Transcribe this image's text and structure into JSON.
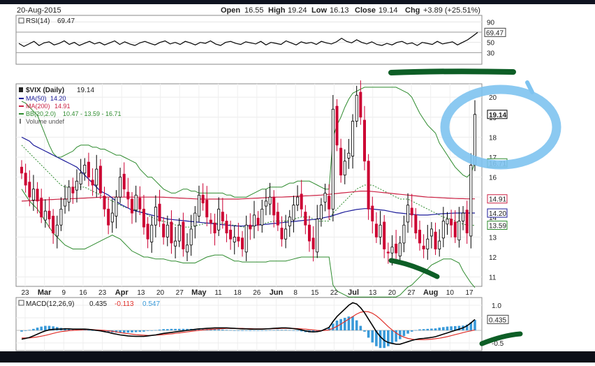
{
  "header": {
    "date": "20-Aug-2015",
    "open_label": "Open",
    "open": "16.55",
    "high_label": "High",
    "high": "19.24",
    "low_label": "Low",
    "low": "16.13",
    "close_label": "Close",
    "close": "19.14",
    "chg_label": "Chg",
    "chg": "+3.89 (+25.51%)"
  },
  "colors": {
    "price_up": "#000000",
    "price_down": "#cc0033",
    "ma50": "#1a1a99",
    "ma200": "#cc2244",
    "bb": "#2e8b2e",
    "macd": "#000000",
    "signal": "#e0302a",
    "hist": "#3a9ad9",
    "highlight_circle": "#7ec3f0",
    "marker_green": "#0d5e26"
  },
  "chart_data": [
    {
      "type": "line",
      "panel": "rsi",
      "legend": [
        {
          "label": "RSI(14)",
          "value": "69.47"
        }
      ],
      "y_ticks": [
        "90",
        "70",
        "50",
        "30"
      ],
      "ylim": [
        10,
        100
      ],
      "current_value_label": "69.47",
      "values": [
        48,
        42,
        47,
        52,
        44,
        49,
        51,
        45,
        48,
        53,
        46,
        50,
        44,
        48,
        52,
        47,
        50,
        45,
        49,
        53,
        46,
        51,
        47,
        44,
        49,
        52,
        48,
        45,
        50,
        53,
        47,
        50,
        46,
        52,
        49,
        45,
        50,
        48,
        53,
        47,
        44,
        50,
        52,
        48,
        46,
        51,
        49,
        47,
        52,
        45,
        50,
        48,
        46,
        53,
        49,
        45,
        51,
        48,
        50,
        46,
        52,
        49,
        47,
        51,
        58,
        52,
        49,
        55,
        50,
        47,
        51,
        46,
        44,
        48,
        45,
        50,
        52,
        47,
        49,
        44,
        50,
        48,
        46,
        52,
        47,
        49,
        51,
        45,
        50,
        55,
        62,
        69.47
      ]
    },
    {
      "type": "line",
      "panel": "price",
      "legend": [
        {
          "label": "$VIX (Daily)",
          "value": "19.14"
        },
        {
          "label": "MA(50)",
          "value": "14.20"
        },
        {
          "label": "MA(200)",
          "value": "14.91"
        },
        {
          "label": "BB(20,2.0)",
          "value": "10.47 - 13.59 - 16.71"
        },
        {
          "label": "Volume undef",
          "value": ""
        }
      ],
      "y_ticks": [
        "20",
        "19",
        "18",
        "17",
        "16",
        "15",
        "14",
        "13",
        "12",
        "11"
      ],
      "ylim": [
        10.6,
        20.6
      ],
      "price_tags": [
        "19.14",
        "16.71",
        "14.91",
        "14.20",
        "13.59"
      ],
      "x_ticks": [
        "23",
        "Mar",
        "9",
        "16",
        "23",
        "Apr",
        "13",
        "20",
        "27",
        "May",
        "11",
        "18",
        "26",
        "Jun",
        "8",
        "15",
        "22",
        "Jul",
        "13",
        "20",
        "27",
        "Aug",
        "10",
        "17"
      ],
      "closes": [
        16.2,
        15.6,
        15.0,
        15.4,
        14.8,
        14.0,
        14.3,
        13.9,
        13.2,
        13.6,
        14.4,
        14.9,
        15.5,
        15.2,
        15.8,
        16.2,
        16.6,
        16.0,
        15.6,
        16.4,
        15.2,
        14.4,
        13.6,
        14.2,
        15.0,
        16.0,
        15.4,
        14.9,
        14.2,
        15.1,
        14.4,
        13.5,
        12.9,
        13.6,
        14.5,
        13.8,
        13.0,
        13.6,
        12.7,
        12.8,
        13.6,
        12.4,
        12.6,
        13.4,
        14.2,
        15.1,
        14.7,
        14.0,
        13.7,
        13.2,
        14.4,
        13.8,
        13.2,
        12.9,
        13.0,
        12.8,
        12.4,
        13.6,
        13.4,
        14.1,
        13.6,
        14.4,
        14.8,
        15.0,
        14.1,
        13.6,
        12.9,
        13.4,
        14.0,
        14.6,
        15.0,
        14.4,
        13.6,
        12.8,
        12.4,
        13.9,
        14.6,
        15.2,
        14.4,
        19.4,
        17.6,
        16.1,
        16.8,
        17.2,
        18.8,
        20.1,
        19.0,
        16.8,
        14.4,
        13.8,
        13.0,
        13.6,
        12.4,
        12.2,
        12.5,
        12.2,
        12.7,
        13.6,
        14.6,
        14.1,
        13.2,
        12.7,
        12.4,
        12.9,
        13.4,
        12.4,
        12.8,
        13.8,
        13.9,
        13.6,
        13.0,
        13.8,
        14.2,
        13.2,
        16.6,
        19.14
      ],
      "ma50": [
        18.0,
        17.9,
        17.8,
        17.6,
        17.5,
        17.4,
        17.3,
        17.2,
        17.1,
        17.0,
        16.9,
        16.8,
        16.7,
        16.6,
        16.5,
        16.3,
        16.1,
        15.9,
        15.7,
        15.5,
        15.3,
        15.2,
        15.1,
        14.95,
        14.8,
        14.65,
        14.55,
        14.45,
        14.35,
        14.3,
        14.25,
        14.2,
        14.15,
        14.1,
        14.05,
        14.0,
        13.95,
        13.9,
        13.88,
        13.86,
        13.84,
        13.82,
        13.8,
        13.78,
        13.76,
        13.74,
        13.72,
        13.7,
        13.68,
        13.66,
        13.64,
        13.62,
        13.6,
        13.58,
        13.56,
        13.55,
        13.55,
        13.56,
        13.57,
        13.58,
        13.6,
        13.62,
        13.64,
        13.66,
        13.68,
        13.7,
        13.72,
        13.74,
        13.76,
        13.78,
        13.8,
        13.82,
        13.84,
        13.86,
        13.88,
        13.9,
        13.94,
        13.98,
        14.02,
        14.08,
        14.14,
        14.2,
        14.26,
        14.3,
        14.34,
        14.38,
        14.4,
        14.42,
        14.42,
        14.4,
        14.38,
        14.36,
        14.34,
        14.3,
        14.26,
        14.22,
        14.2,
        14.18,
        14.16,
        14.14,
        14.12,
        14.1,
        14.1,
        14.1,
        14.12,
        14.14,
        14.16,
        14.17,
        14.18,
        14.19,
        14.2,
        14.2,
        14.2,
        14.2,
        14.2,
        14.2
      ],
      "ma200": [
        14.8,
        14.81,
        14.82,
        14.83,
        14.84,
        14.85,
        14.86,
        14.87,
        14.88,
        14.89,
        14.9,
        14.9,
        14.91,
        14.92,
        14.93,
        14.94,
        14.95,
        14.96,
        14.97,
        14.98,
        14.99,
        15.0,
        15.0,
        15.0,
        15.0,
        15.0,
        15.0,
        15.0,
        15.0,
        15.0,
        15.0,
        15.0,
        15.0,
        15.0,
        15.0,
        15.0,
        14.99,
        14.98,
        14.97,
        14.96,
        14.95,
        14.94,
        14.93,
        14.92,
        14.91,
        14.9,
        14.9,
        14.9,
        14.9,
        14.9,
        14.9,
        14.9,
        14.9,
        14.9,
        14.9,
        14.9,
        14.91,
        14.92,
        14.93,
        14.94,
        14.95,
        14.96,
        14.97,
        14.98,
        14.99,
        15.0,
        15.0,
        15.01,
        15.02,
        15.03,
        15.04,
        15.05,
        15.06,
        15.07,
        15.08,
        15.09,
        15.1,
        15.12,
        15.14,
        15.16,
        15.18,
        15.2,
        15.22,
        15.24,
        15.26,
        15.28,
        15.3,
        15.3,
        15.3,
        15.28,
        15.26,
        15.24,
        15.22,
        15.2,
        15.18,
        15.16,
        15.14,
        15.12,
        15.1,
        15.08,
        15.06,
        15.04,
        15.02,
        15.0,
        14.99,
        14.98,
        14.97,
        14.96,
        14.95,
        14.94,
        14.93,
        14.92,
        14.92,
        14.91,
        14.91,
        14.91
      ],
      "bb_upper": [
        19.8,
        19.7,
        19.5,
        19.3,
        19.1,
        18.6,
        18.1,
        17.6,
        17.2,
        17.0,
        17.0,
        17.1,
        17.2,
        17.3,
        17.5,
        17.6,
        17.6,
        17.6,
        17.5,
        17.5,
        17.4,
        17.4,
        17.3,
        17.2,
        17.1,
        17.1,
        17.0,
        16.9,
        16.8,
        16.7,
        16.4,
        16.2,
        16.0,
        16.0,
        15.8,
        15.6,
        15.4,
        15.3,
        15.2,
        15.2,
        15.3,
        15.4,
        15.4,
        15.3,
        15.3,
        15.2,
        15.2,
        15.2,
        15.2,
        15.2,
        15.2,
        15.2,
        15.1,
        15.1,
        15.0,
        15.0,
        15.0,
        15.0,
        15.1,
        15.2,
        15.3,
        15.4,
        15.4,
        15.5,
        15.5,
        15.5,
        15.5,
        15.6,
        15.7,
        15.7,
        15.8,
        15.8,
        15.8,
        15.8,
        15.7,
        15.6,
        15.5,
        15.4,
        15.4,
        18.0,
        18.6,
        19.0,
        19.5,
        19.9,
        20.2,
        20.3,
        20.4,
        20.5,
        20.5,
        20.5,
        20.5,
        20.5,
        20.5,
        20.5,
        20.5,
        20.5,
        20.4,
        20.3,
        20.2,
        20.0,
        19.6,
        19.2,
        18.9,
        18.6,
        18.4,
        18.2,
        17.7,
        17.4,
        17.1,
        16.8,
        16.5,
        16.3,
        16.1,
        16.0,
        16.2,
        16.71
      ],
      "bb_middle": [
        17.6,
        17.4,
        17.2,
        17.0,
        16.8,
        16.6,
        16.4,
        16.2,
        16.0,
        15.8,
        15.6,
        15.5,
        15.5,
        15.5,
        15.5,
        15.5,
        15.5,
        15.4,
        15.3,
        15.2,
        15.1,
        15.0,
        14.9,
        14.8,
        14.7,
        14.6,
        14.5,
        14.45,
        14.4,
        14.35,
        14.3,
        14.2,
        14.1,
        14.0,
        13.9,
        13.8,
        13.8,
        13.7,
        13.7,
        13.6,
        13.6,
        13.5,
        13.5,
        13.5,
        13.55,
        13.6,
        13.65,
        13.7,
        13.7,
        13.7,
        13.7,
        13.7,
        13.65,
        13.6,
        13.6,
        13.55,
        13.5,
        13.5,
        13.5,
        13.55,
        13.6,
        13.65,
        13.7,
        13.75,
        13.8,
        13.8,
        13.8,
        13.8,
        13.85,
        13.9,
        13.95,
        14.0,
        14.0,
        14.0,
        13.9,
        13.8,
        13.8,
        13.8,
        13.8,
        14.2,
        14.4,
        14.6,
        14.8,
        15.0,
        15.2,
        15.4,
        15.5,
        15.6,
        15.6,
        15.6,
        15.5,
        15.4,
        15.3,
        15.2,
        15.1,
        15.0,
        14.9,
        14.9,
        14.9,
        14.8,
        14.7,
        14.6,
        14.5,
        14.4,
        14.3,
        14.2,
        14.1,
        14.0,
        13.95,
        13.9,
        13.8,
        13.7,
        13.65,
        13.6,
        13.59,
        13.59
      ],
      "bb_lower": [
        15.4,
        15.1,
        14.8,
        14.6,
        14.4,
        14.1,
        13.8,
        13.5,
        13.2,
        13.0,
        12.8,
        12.6,
        12.5,
        12.4,
        12.4,
        12.4,
        12.4,
        12.5,
        12.6,
        12.7,
        12.8,
        12.9,
        13.0,
        13.1,
        13.0,
        12.9,
        12.7,
        12.5,
        12.3,
        12.2,
        12.1,
        12.0,
        12.0,
        11.95,
        11.9,
        11.9,
        11.9,
        11.85,
        11.8,
        11.8,
        11.75,
        11.7,
        11.7,
        11.7,
        11.7,
        11.8,
        11.9,
        12.0,
        12.05,
        12.1,
        12.1,
        12.1,
        12.0,
        11.9,
        11.8,
        11.8,
        11.75,
        11.75,
        11.75,
        11.75,
        11.75,
        11.75,
        11.75,
        11.8,
        11.8,
        11.8,
        11.8,
        11.8,
        11.85,
        11.9,
        11.95,
        12.0,
        12.0,
        12.0,
        12.0,
        12.0,
        12.0,
        12.0,
        12.0,
        10.6,
        10.3,
        10.2,
        10.1,
        10.0,
        10.0,
        10.0,
        10.0,
        10.0,
        10.0,
        10.0,
        10.0,
        10.0,
        10.0,
        10.0,
        10.0,
        10.0,
        10.1,
        10.3,
        10.5,
        10.6,
        10.8,
        11.0,
        11.2,
        11.4,
        11.6,
        11.7,
        11.8,
        11.9,
        11.9,
        11.9,
        11.8,
        11.7,
        11.3,
        11.0,
        10.7,
        10.47
      ]
    },
    {
      "type": "bar",
      "panel": "macd",
      "legend": [
        {
          "label": "MACD(12,26,9)",
          "value": "0.435"
        },
        {
          "label": "",
          "value": "-0.113"
        },
        {
          "label": "",
          "value": "0.547"
        }
      ],
      "y_ticks": [
        "1.0",
        "0.5",
        "-0.5"
      ],
      "ylim": [
        -0.75,
        1.25
      ],
      "value_tag": "0.435",
      "macd": [
        -0.35,
        -0.32,
        -0.28,
        -0.22,
        -0.15,
        -0.08,
        -0.02,
        0.02,
        0.04,
        0.05,
        0.05,
        0.06,
        0.06,
        0.05,
        0.05,
        0.05,
        0.05,
        0.04,
        0.02,
        0.0,
        -0.02,
        -0.05,
        -0.08,
        -0.12,
        -0.15,
        -0.18,
        -0.2,
        -0.22,
        -0.23,
        -0.24,
        -0.24,
        -0.24,
        -0.22,
        -0.2,
        -0.18,
        -0.15,
        -0.12,
        -0.1,
        -0.08,
        -0.06,
        -0.04,
        -0.02,
        0.0,
        0.02,
        0.04,
        0.06,
        0.07,
        0.08,
        0.09,
        0.1,
        0.1,
        0.1,
        0.1,
        0.09,
        0.08,
        0.07,
        0.06,
        0.06,
        0.05,
        0.05,
        0.05,
        0.05,
        0.06,
        0.07,
        0.08,
        0.09,
        0.1,
        0.1,
        0.09,
        0.07,
        0.05,
        0.02,
        -0.02,
        -0.05,
        -0.06,
        -0.05,
        -0.02,
        0.05,
        0.12,
        0.35,
        0.55,
        0.7,
        0.85,
        1.0,
        1.1,
        1.05,
        0.9,
        0.7,
        0.45,
        0.2,
        -0.05,
        -0.25,
        -0.4,
        -0.48,
        -0.52,
        -0.55,
        -0.55,
        -0.5,
        -0.45,
        -0.4,
        -0.36,
        -0.33,
        -0.32,
        -0.3,
        -0.28,
        -0.25,
        -0.2,
        -0.15,
        -0.1,
        -0.05,
        0.0,
        0.05,
        0.1,
        0.18,
        0.3,
        0.435
      ],
      "signal": [
        -0.3,
        -0.3,
        -0.3,
        -0.28,
        -0.26,
        -0.23,
        -0.2,
        -0.16,
        -0.12,
        -0.08,
        -0.05,
        -0.03,
        -0.01,
        0.0,
        0.01,
        0.02,
        0.03,
        0.03,
        0.03,
        0.02,
        0.01,
        0.0,
        -0.02,
        -0.04,
        -0.06,
        -0.09,
        -0.11,
        -0.13,
        -0.15,
        -0.17,
        -0.18,
        -0.19,
        -0.2,
        -0.2,
        -0.19,
        -0.18,
        -0.17,
        -0.15,
        -0.14,
        -0.12,
        -0.1,
        -0.08,
        -0.06,
        -0.04,
        -0.02,
        0.0,
        0.02,
        0.03,
        0.04,
        0.05,
        0.06,
        0.07,
        0.08,
        0.08,
        0.08,
        0.08,
        0.08,
        0.07,
        0.07,
        0.06,
        0.06,
        0.06,
        0.06,
        0.06,
        0.07,
        0.07,
        0.08,
        0.08,
        0.08,
        0.08,
        0.07,
        0.06,
        0.05,
        0.03,
        0.02,
        0.0,
        -0.01,
        0.0,
        0.02,
        0.08,
        0.16,
        0.25,
        0.35,
        0.45,
        0.55,
        0.65,
        0.72,
        0.75,
        0.74,
        0.68,
        0.58,
        0.45,
        0.3,
        0.15,
        0.02,
        -0.1,
        -0.2,
        -0.27,
        -0.32,
        -0.35,
        -0.37,
        -0.37,
        -0.37,
        -0.36,
        -0.35,
        -0.33,
        -0.31,
        -0.28,
        -0.25,
        -0.21,
        -0.17,
        -0.13,
        -0.09,
        -0.05,
        -0.02,
        0.02
      ]
    }
  ]
}
